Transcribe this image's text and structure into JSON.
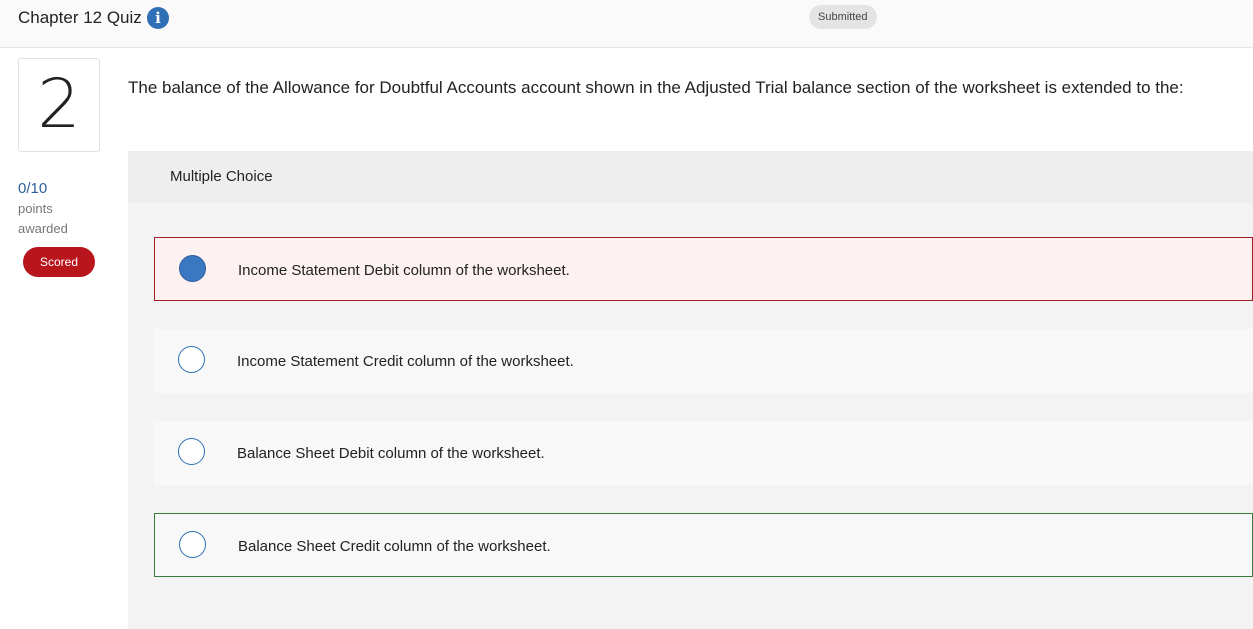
{
  "header": {
    "quiz_title": "Chapter 12 Quiz",
    "info_icon": "info-icon",
    "status": "Submitted"
  },
  "sidebar": {
    "question_number": "2",
    "score": "0/10",
    "points_label": "points",
    "awarded_label": "awarded",
    "badge": "Scored"
  },
  "question": {
    "text": "The balance of the Allowance for Doubtful Accounts account shown in the Adjusted Trial balance section of the worksheet is extended to the:",
    "type_label": "Multiple Choice",
    "options": [
      {
        "label": "Income Statement Debit column of the worksheet.",
        "selected": true,
        "state": "incorrect"
      },
      {
        "label": "Income Statement Credit column of the worksheet.",
        "selected": false,
        "state": "neutral"
      },
      {
        "label": "Balance Sheet Debit column of the worksheet.",
        "selected": false,
        "state": "neutral"
      },
      {
        "label": "Balance Sheet Credit column of the worksheet.",
        "selected": false,
        "state": "correct"
      }
    ]
  },
  "colors": {
    "accent_blue": "#2f6fb5",
    "incorrect_red": "#a51d24",
    "correct_green": "#3b7a3b",
    "badge_red": "#b8161c"
  }
}
